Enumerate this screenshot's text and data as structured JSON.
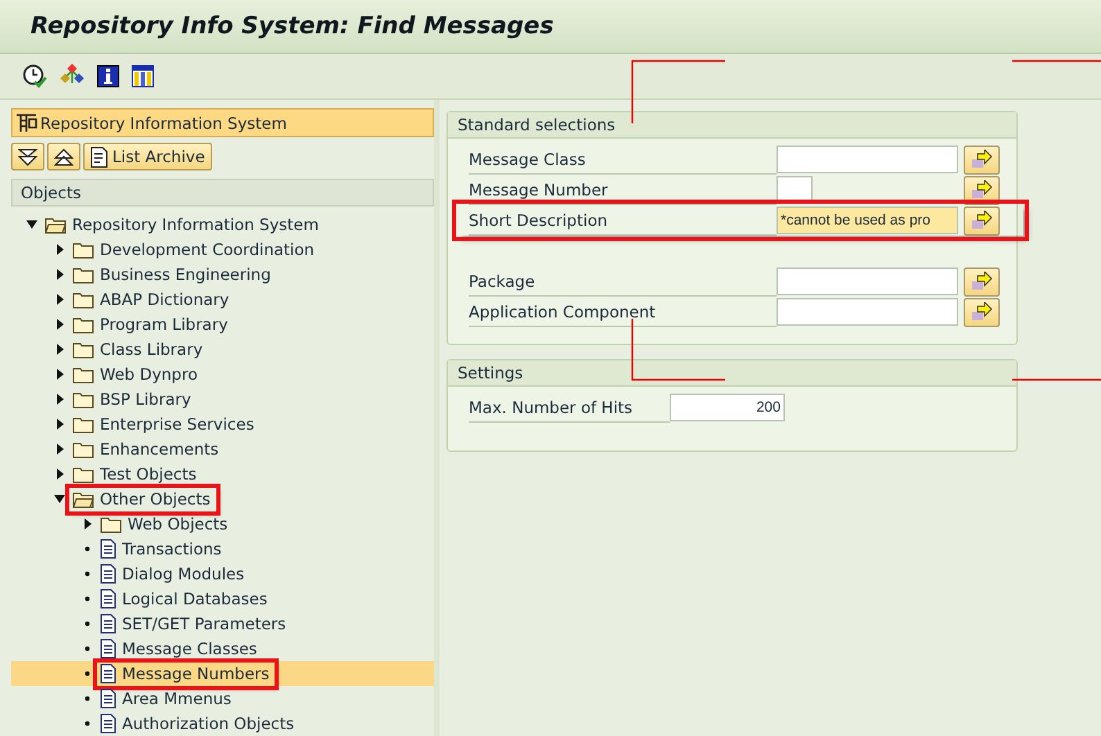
{
  "window": {
    "title": "Repository Info System: Find Messages"
  },
  "left_panel": {
    "header": "Repository Information System",
    "buttons": [
      {
        "kind": "expand"
      },
      {
        "kind": "collapse"
      },
      {
        "kind": "archive",
        "label": "List Archive"
      }
    ],
    "section": "Objects",
    "tree": [
      {
        "label": "Repository Information System",
        "kind": "folder",
        "expanded": true,
        "selected": false,
        "highlighted": false,
        "children": [
          {
            "label": "Development Coordination",
            "kind": "folder",
            "expanded": false,
            "selected": false,
            "highlighted": false
          },
          {
            "label": "Business Engineering",
            "kind": "folder",
            "expanded": false,
            "selected": false,
            "highlighted": false
          },
          {
            "label": "ABAP Dictionary",
            "kind": "folder",
            "expanded": false,
            "selected": false,
            "highlighted": false
          },
          {
            "label": "Program Library",
            "kind": "folder",
            "expanded": false,
            "selected": false,
            "highlighted": false
          },
          {
            "label": "Class Library",
            "kind": "folder",
            "expanded": false,
            "selected": false,
            "highlighted": false
          },
          {
            "label": "Web Dynpro",
            "kind": "folder",
            "expanded": false,
            "selected": false,
            "highlighted": false
          },
          {
            "label": "BSP Library",
            "kind": "folder",
            "expanded": false,
            "selected": false,
            "highlighted": false
          },
          {
            "label": "Enterprise Services",
            "kind": "folder",
            "expanded": false,
            "selected": false,
            "highlighted": false
          },
          {
            "label": "Enhancements",
            "kind": "folder",
            "expanded": false,
            "selected": false,
            "highlighted": false
          },
          {
            "label": "Test Objects",
            "kind": "folder",
            "expanded": false,
            "selected": false,
            "highlighted": false
          },
          {
            "label": "Other Objects",
            "kind": "folder",
            "expanded": true,
            "selected": false,
            "highlighted": true,
            "children": [
              {
                "label": "Web Objects",
                "kind": "folder",
                "expanded": false,
                "selected": false,
                "highlighted": false
              },
              {
                "label": "Transactions",
                "kind": "document",
                "selected": false,
                "highlighted": false
              },
              {
                "label": "Dialog Modules",
                "kind": "document",
                "selected": false,
                "highlighted": false
              },
              {
                "label": "Logical Databases",
                "kind": "document",
                "selected": false,
                "highlighted": false
              },
              {
                "label": "SET/GET Parameters",
                "kind": "document",
                "selected": false,
                "highlighted": false
              },
              {
                "label": "Message Classes",
                "kind": "document",
                "selected": false,
                "highlighted": false
              },
              {
                "label": "Message Numbers",
                "kind": "document",
                "selected": true,
                "highlighted": true
              },
              {
                "label": "Area Mmenus",
                "kind": "document",
                "selected": false,
                "highlighted": false
              },
              {
                "label": "Authorization Objects",
                "kind": "document",
                "selected": false,
                "highlighted": false
              }
            ]
          }
        ]
      }
    ]
  },
  "standard_selections": {
    "title": "Standard selections",
    "field_groups": [
      [
        {
          "label": "Message Class",
          "kind": "long",
          "focused": false,
          "highlighted": false
        },
        {
          "label": "Message Number",
          "kind": "short",
          "focused": false,
          "highlighted": false
        },
        {
          "label": "Short Description",
          "kind": "long",
          "value": "*cannot be used as pro",
          "focused": true,
          "highlighted": true
        }
      ],
      [
        {
          "label": "Package",
          "kind": "long",
          "focused": false,
          "highlighted": false
        },
        {
          "label": "Application Component",
          "kind": "long",
          "focused": false,
          "highlighted": false
        }
      ]
    ]
  },
  "settings": {
    "title": "Settings",
    "fields": [
      {
        "label": "Max. Number of Hits",
        "value": "200"
      }
    ]
  }
}
